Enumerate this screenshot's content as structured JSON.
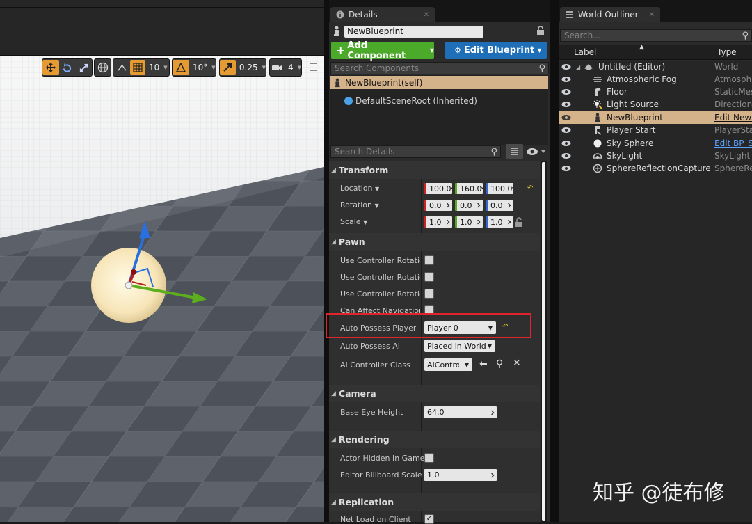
{
  "viewport": {
    "toolbar": {
      "grid_snap_value": "10",
      "rotation_snap_value": "10°",
      "scale_snap_value": "0.25",
      "camera_speed_value": "4"
    }
  },
  "details_panel": {
    "tab_title": "Details",
    "actor_name": "NewBlueprint",
    "add_component_label": "Add Component",
    "edit_blueprint_label": "Edit Blueprint",
    "search_components_placeholder": "Search Components",
    "components": [
      {
        "label": "NewBlueprint(self)",
        "selected": true
      },
      {
        "label": "DefaultSceneRoot (Inherited)",
        "selected": false
      }
    ],
    "search_details_placeholder": "Search Details",
    "sections": {
      "transform": {
        "title": "Transform",
        "location_label": "Location",
        "location": [
          "100.0",
          "160.0",
          "100.0"
        ],
        "rotation_label": "Rotation",
        "rotation": [
          "0.0",
          "0.0",
          "0.0"
        ],
        "scale_label": "Scale",
        "scale": [
          "1.0",
          "1.0",
          "1.0"
        ]
      },
      "pawn": {
        "title": "Pawn",
        "use_controller_rotation_pitch_label": "Use Controller Rotation",
        "use_controller_rotation_yaw_label": "Use Controller Rotation",
        "use_controller_rotation_roll_label": "Use Controller Rotation",
        "can_affect_navigation_label": "Can Affect Navigation (",
        "auto_possess_player_label": "Auto Possess Player",
        "auto_possess_player_value": "Player 0",
        "auto_possess_ai_label": "Auto Possess AI",
        "auto_possess_ai_value": "Placed in World",
        "ai_controller_class_label": "AI Controller Class",
        "ai_controller_class_value": "AIControlle"
      },
      "camera": {
        "title": "Camera",
        "base_eye_height_label": "Base Eye Height",
        "base_eye_height_value": "64.0"
      },
      "rendering": {
        "title": "Rendering",
        "actor_hidden_in_game_label": "Actor Hidden In Game",
        "editor_billboard_scale_label": "Editor Billboard Scale",
        "editor_billboard_scale_value": "1.0"
      },
      "replication": {
        "title": "Replication",
        "net_load_on_client_label": "Net Load on Client"
      }
    }
  },
  "world_outliner": {
    "tab_title": "World Outliner",
    "search_placeholder": "Search...",
    "col_label": "Label",
    "col_type": "Type",
    "rows": [
      {
        "name": "Untitled (Editor)",
        "type": "World",
        "icon": "world-icon"
      },
      {
        "name": "Atmospheric Fog",
        "type": "Atmospheric",
        "icon": "fog-icon"
      },
      {
        "name": "Floor",
        "type": "StaticMesh",
        "icon": "static-mesh-icon"
      },
      {
        "name": "Light Source",
        "type": "Directional",
        "icon": "light-icon"
      },
      {
        "name": "NewBlueprint",
        "type": "Edit NewBlueprint",
        "icon": "pawn-icon"
      },
      {
        "name": "Player Start",
        "type": "PlayerStart",
        "icon": "player-start-icon"
      },
      {
        "name": "Sky Sphere",
        "type": "Edit BP_Sky",
        "icon": "sphere-icon"
      },
      {
        "name": "SkyLight",
        "type": "SkyLight",
        "icon": "skylight-icon"
      },
      {
        "name": "SphereReflectionCapture",
        "type": "SphereReflection",
        "icon": "reflection-icon"
      }
    ]
  },
  "watermark": "知乎 @徒布修",
  "colors": {
    "accent_orange": "#e59b31",
    "add_component_green": "#4caa2b",
    "edit_blueprint_blue": "#1f6fb8",
    "selected_row": "#d4b28a",
    "highlight_box": "#e0242c"
  }
}
